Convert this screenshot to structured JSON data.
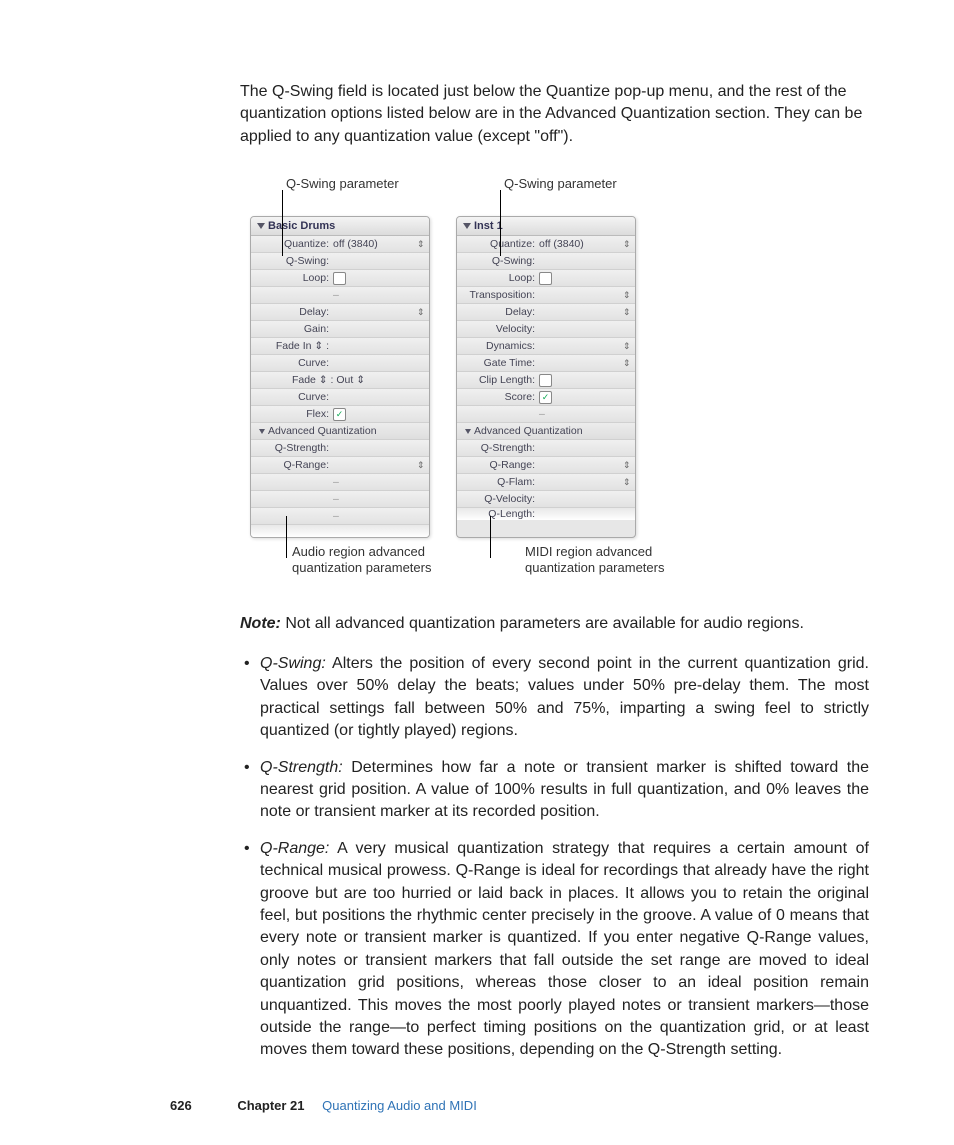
{
  "intro": "The Q-Swing field is located just below the Quantize pop-up menu, and the rest of the quantization options listed below are in the Advanced Quantization section. They can be applied to any quantization value (except \"off\").",
  "callouts": {
    "top_left": "Q-Swing parameter",
    "top_right": "Q-Swing parameter",
    "bottom_left": "Audio region advanced quantization parameters",
    "bottom_right": "MIDI region advanced quantization parameters"
  },
  "panel_left": {
    "title": "Basic Drums",
    "quantize_label": "Quantize:",
    "quantize_value": "off (3840)",
    "qswing_label": "Q-Swing:",
    "loop_label": "Loop:",
    "delay_label": "Delay:",
    "gain_label": "Gain:",
    "fadein_label": "Fade In ⇕ :",
    "curve1_label": "Curve:",
    "fadeout_label": "Fade ⇕ : Out    ⇕",
    "curve2_label": "Curve:",
    "flex_label": "Flex:",
    "adv_section": "Advanced Quantization",
    "qstrength_label": "Q-Strength:",
    "qrange_label": "Q-Range:"
  },
  "panel_right": {
    "title": "Inst 1",
    "quantize_label": "Quantize:",
    "quantize_value": "off (3840)",
    "qswing_label": "Q-Swing:",
    "loop_label": "Loop:",
    "transposition_label": "Transposition:",
    "delay_label": "Delay:",
    "velocity_label": "Velocity:",
    "dynamics_label": "Dynamics:",
    "gatetime_label": "Gate Time:",
    "cliplength_label": "Clip Length:",
    "score_label": "Score:",
    "adv_section": "Advanced Quantization",
    "qstrength_label": "Q-Strength:",
    "qrange_label": "Q-Range:",
    "qflam_label": "Q-Flam:",
    "qvelocity_label": "Q-Velocity:",
    "qlength_label": "Q-Length:"
  },
  "note_label": "Note:",
  "note_text": "Not all advanced quantization parameters are available for audio regions.",
  "defs": [
    {
      "term": "Q-Swing:",
      "text": "Alters the position of every second point in the current quantization grid. Values over 50% delay the beats; values under 50% pre-delay them. The most practical settings fall between 50% and 75%, imparting a swing feel to strictly quantized (or tightly played) regions."
    },
    {
      "term": "Q-Strength:",
      "text": "Determines how far a note or transient marker is shifted toward the nearest grid position. A value of 100% results in full quantization, and 0% leaves the note or transient marker at its recorded position."
    },
    {
      "term": "Q-Range:",
      "text": "A very musical quantization strategy that requires a certain amount of technical musical prowess. Q-Range is ideal for recordings that already have the right groove but are too hurried or laid back in places. It allows you to retain the original feel, but positions the rhythmic center precisely in the groove. A value of 0 means that every note or transient marker is quantized. If you enter negative Q-Range values, only notes or transient markers that fall outside the set range are moved to ideal quantization grid positions, whereas those closer to an ideal position remain unquantized. This moves the most poorly played notes or transient markers—those outside the range—to perfect timing positions on the quantization grid, or at least moves them toward these positions, depending on the Q-Strength setting."
    }
  ],
  "footer": {
    "page": "626",
    "chapter_label": "Chapter 21",
    "chapter_title": "Quantizing Audio and MIDI"
  },
  "glyphs": {
    "stepper": "⇕",
    "check": "✓"
  }
}
